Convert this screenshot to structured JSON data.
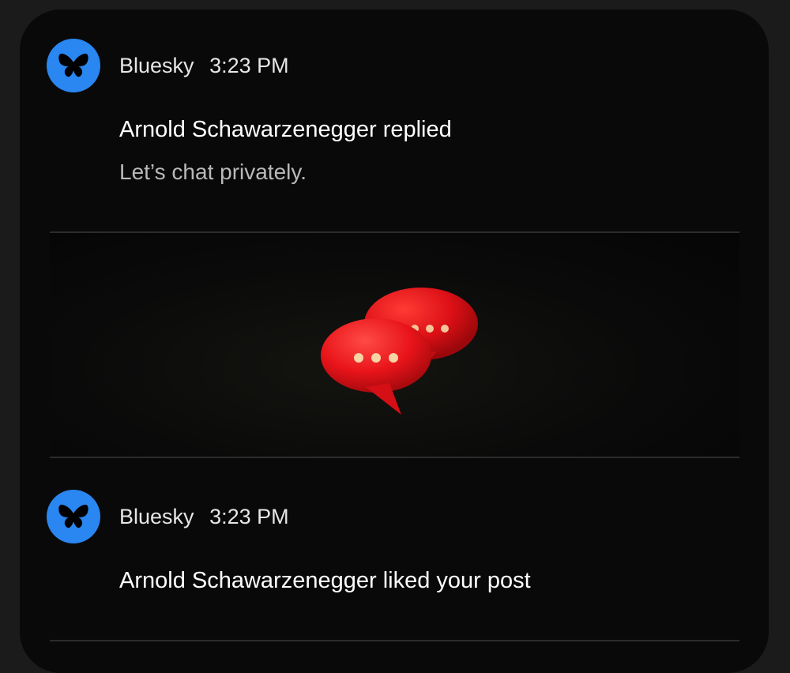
{
  "notifications": [
    {
      "app_name": "Bluesky",
      "time": "3:23 PM",
      "title": "Arnold Schawarzenegger replied",
      "body": "Let’s chat privately.",
      "app_icon": "butterfly-icon",
      "image": "red-chat-bubbles-image"
    },
    {
      "app_name": "Bluesky",
      "time": "3:23 PM",
      "title": "Arnold Schawarzenegger liked your post",
      "app_icon": "butterfly-icon"
    }
  ],
  "colors": {
    "background": "#090909",
    "brand_blue": "#2a86f0",
    "bubble_red": "#e8141a"
  }
}
